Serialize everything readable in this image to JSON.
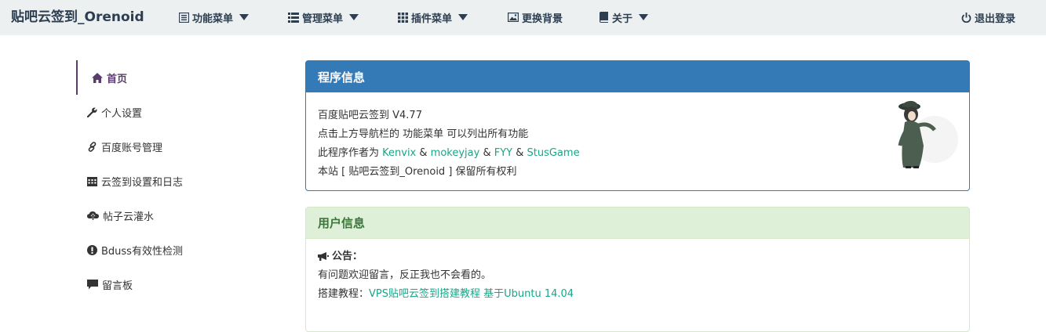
{
  "navbar": {
    "brand": "贴吧云签到_Orenoid",
    "items": [
      {
        "label": "功能菜单",
        "icon": "list-icon"
      },
      {
        "label": "管理菜单",
        "icon": "th-list-icon"
      },
      {
        "label": "插件菜单",
        "icon": "th-icon"
      },
      {
        "label": "更换背景",
        "icon": "picture-icon"
      },
      {
        "label": "关于",
        "icon": "book-icon"
      }
    ],
    "logout": "退出登录"
  },
  "sidebar": {
    "items": [
      {
        "label": "首页",
        "icon": "home-icon"
      },
      {
        "label": "个人设置",
        "icon": "wrench-icon"
      },
      {
        "label": "百度账号管理",
        "icon": "link-icon"
      },
      {
        "label": "云签到设置和日志",
        "icon": "calendar-icon"
      },
      {
        "label": "帖子云灌水",
        "icon": "cloud-upload-icon"
      },
      {
        "label": "Bduss有效性检测",
        "icon": "exclamation-sign-icon"
      },
      {
        "label": "留言板",
        "icon": "comment-icon"
      }
    ]
  },
  "program_panel": {
    "title": "程序信息",
    "version_line": "百度贴吧云签到 V4.77",
    "hint_line": "点击上方导航栏的 功能菜单 可以列出所有功能",
    "author_prefix": "此程序作者为 ",
    "authors": [
      "Kenvix",
      "mokeyjay",
      "FYY",
      "StusGame"
    ],
    "amp": " & ",
    "rights_line": "本站 [ 贴吧云签到_Orenoid ] 保留所有权利"
  },
  "user_panel": {
    "title": "用户信息",
    "notice_label": "公告：",
    "notice_text": "有问题欢迎留言，反正我也不会看的。",
    "tutorial_prefix": "搭建教程：",
    "tutorial_link": "VPS贴吧云签到搭建教程 基于Ubuntu 14.04"
  },
  "colors": {
    "navbar_bg": "#ecf0f1",
    "primary": "#337ab7",
    "success_bg": "#dff0d8",
    "link": "#18a689",
    "active": "#5a3c6e"
  }
}
